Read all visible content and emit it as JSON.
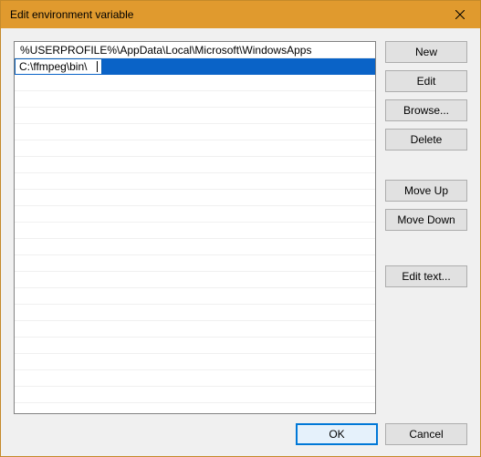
{
  "title": "Edit environment variable",
  "list": {
    "entries": [
      "%USERPROFILE%\\AppData\\Local\\Microsoft\\WindowsApps",
      "C:\\ffmpeg\\bin\\"
    ],
    "selected_index": 1,
    "editing_index": 1
  },
  "buttons": {
    "new": "New",
    "edit": "Edit",
    "browse": "Browse...",
    "delete": "Delete",
    "move_up": "Move Up",
    "move_down": "Move Down",
    "edit_text": "Edit text...",
    "ok": "OK",
    "cancel": "Cancel"
  }
}
